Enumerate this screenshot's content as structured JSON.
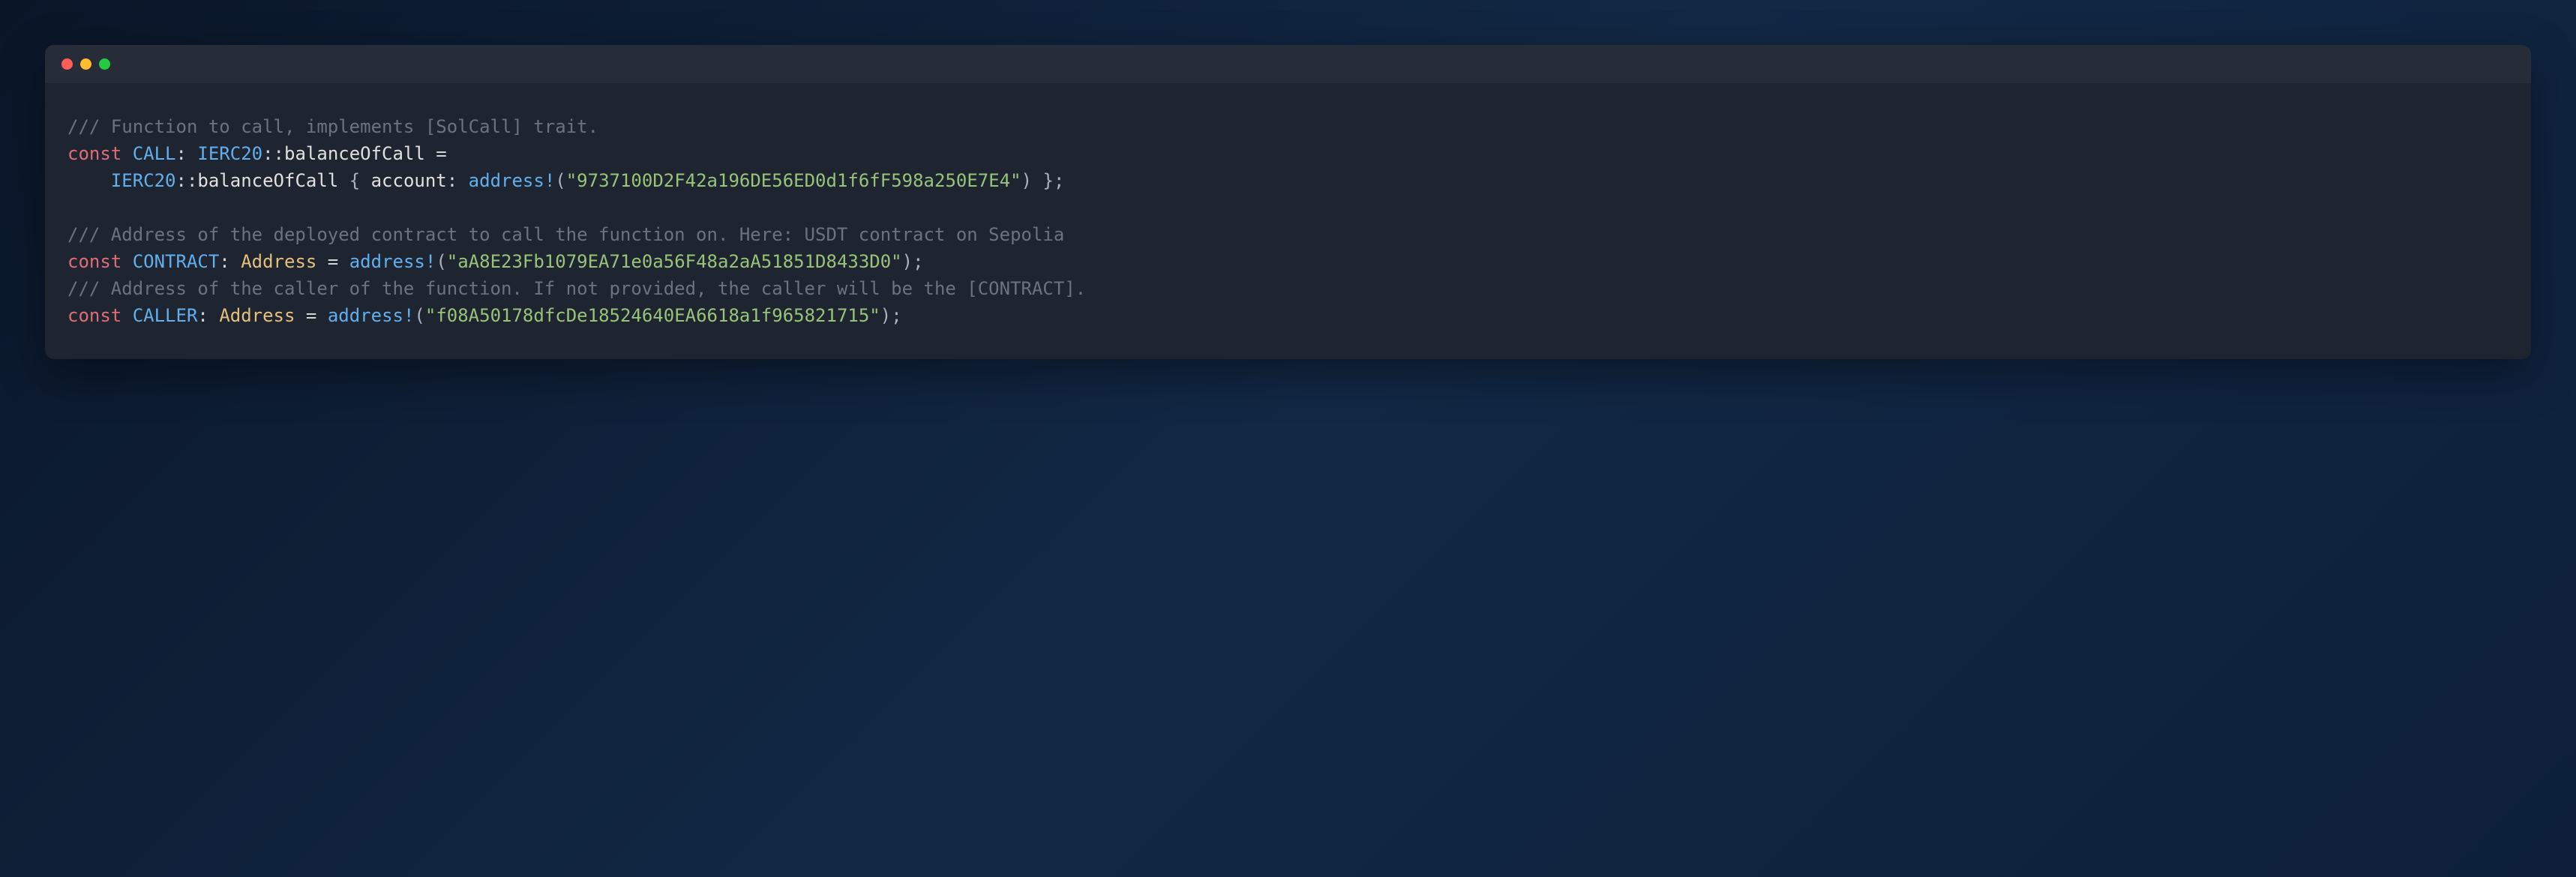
{
  "colors": {
    "comment": "#6b7280",
    "keyword": "#e06c75",
    "type": "#61afef",
    "func": "#e5c07b",
    "string": "#98c379"
  },
  "code": {
    "line1": {
      "comment": "/// Function to call, implements [SolCall] trait."
    },
    "line2": {
      "const": "const",
      "call": "CALL",
      "colon": ":",
      "type1": "IERC20",
      "sep": "::",
      "type2": "balanceOfCall",
      "eq": " ="
    },
    "line3": {
      "indent": "    ",
      "type1": "IERC20",
      "sep": "::",
      "type2": "balanceOfCall",
      "brace": " { ",
      "field": "account",
      "colon": ":",
      "macro": "address!",
      "paren": "(",
      "str": "\"9737100D2F42a196DE56ED0d1f6fF598a250E7E4\"",
      "close": ") };"
    },
    "line4": {
      "blank": ""
    },
    "line5": {
      "comment": "/// Address of the deployed contract to call the function on. Here: USDT contract on Sepolia"
    },
    "line6": {
      "const": "const",
      "name": "CONTRACT",
      "colon": ":",
      "type": "Address",
      "eq": " = ",
      "macro": "address!",
      "paren": "(",
      "str": "\"aA8E23Fb1079EA71e0a56F48a2aA51851D8433D0\"",
      "close": ");"
    },
    "line7": {
      "comment": "/// Address of the caller of the function. If not provided, the caller will be the [CONTRACT]."
    },
    "line8": {
      "const": "const",
      "name": "CALLER",
      "colon": ":",
      "type": "Address",
      "eq": " = ",
      "macro": "address!",
      "paren": "(",
      "str": "\"f08A50178dfcDe18524640EA6618a1f965821715\"",
      "close": ");"
    }
  }
}
